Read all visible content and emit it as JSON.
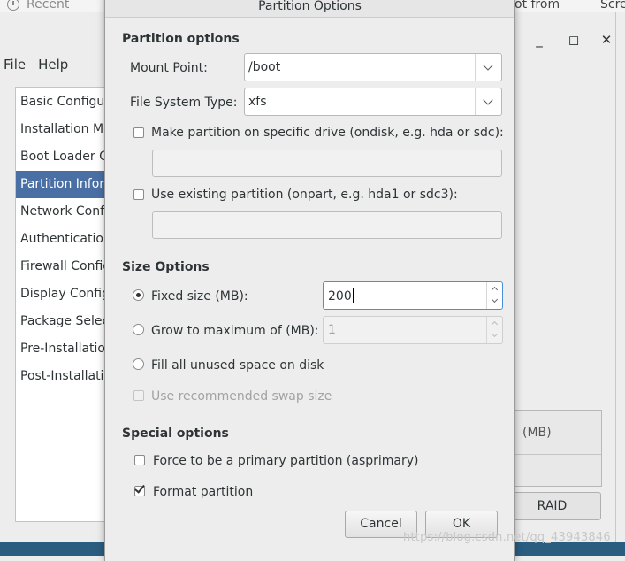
{
  "background": {
    "recent_label": "Recent",
    "hint_text_1": "ot from",
    "hint_text_2": "Scre",
    "menu": {
      "file": "File",
      "help": "Help"
    },
    "window_buttons": {
      "minimize": "_",
      "maximize": "◻",
      "close": "✕"
    },
    "sidebar_items": [
      {
        "label": "Basic Configuration"
      },
      {
        "label": "Installation Method"
      },
      {
        "label": "Boot Loader Options"
      },
      {
        "label": "Partition Information"
      },
      {
        "label": "Network Configuration"
      },
      {
        "label": "Authentication"
      },
      {
        "label": "Firewall Configuration"
      },
      {
        "label": "Display Configuration"
      },
      {
        "label": "Package Selection"
      },
      {
        "label": "Pre-Installation Script"
      },
      {
        "label": "Post-Installation Script"
      }
    ],
    "selected_sidebar_index": 3,
    "panel_header": "(MB)",
    "raid_button": "RAID",
    "watermark": "https://blog.csdn.net/qq_43943846"
  },
  "dialog": {
    "title": "Partition Options",
    "partition_options": {
      "heading": "Partition options",
      "mount_point_label": "Mount Point:",
      "mount_point_value": "/boot",
      "fs_type_label": "File System Type:",
      "fs_type_value": "xfs",
      "specific_drive_label": "Make partition on specific drive (ondisk, e.g. hda or sdc):",
      "specific_drive_value": "",
      "existing_partition_label": "Use existing partition (onpart, e.g. hda1 or sdc3):",
      "existing_partition_value": ""
    },
    "size_options": {
      "heading": "Size Options",
      "fixed_size_label": "Fixed size (MB):",
      "fixed_size_value": "200",
      "grow_label": "Grow to maximum of (MB):",
      "grow_value": "1",
      "fill_label": "Fill all unused space on disk",
      "swap_label": "Use recommended swap size",
      "selected": "fixed"
    },
    "special_options": {
      "heading": "Special options",
      "primary_label": "Force to be a primary partition (asprimary)",
      "primary_checked": false,
      "format_label": "Format partition",
      "format_checked": true
    },
    "buttons": {
      "cancel": "Cancel",
      "ok": "OK"
    }
  }
}
